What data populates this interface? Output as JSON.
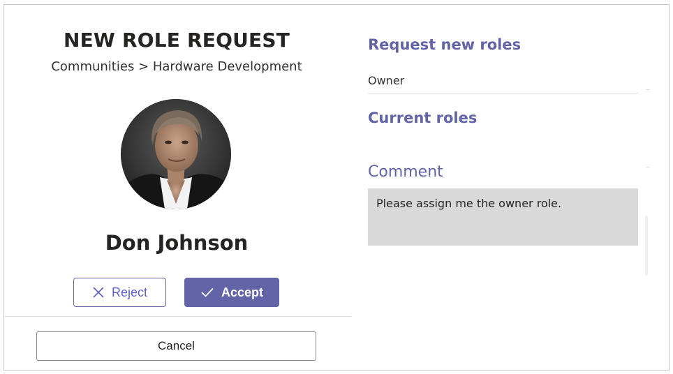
{
  "dialog": {
    "title": "NEW ROLE REQUEST",
    "breadcrumb": "Communities > Hardware Development",
    "user_name": "Don Johnson",
    "avatar_icon": "user-photo-avatar"
  },
  "actions": {
    "reject_label": "Reject",
    "reject_icon": "close-icon",
    "accept_label": "Accept",
    "accept_icon": "checkmark-icon",
    "cancel_label": "Cancel"
  },
  "details": {
    "request_heading": "Request new roles",
    "requested_roles": [
      "Owner"
    ],
    "current_heading": "Current roles",
    "comment_heading": "Comment",
    "comment_text": "Please assign me the owner role."
  },
  "colors": {
    "accent": "#6264a7",
    "comment_background": "#d9d9d9",
    "text": "#252423"
  }
}
